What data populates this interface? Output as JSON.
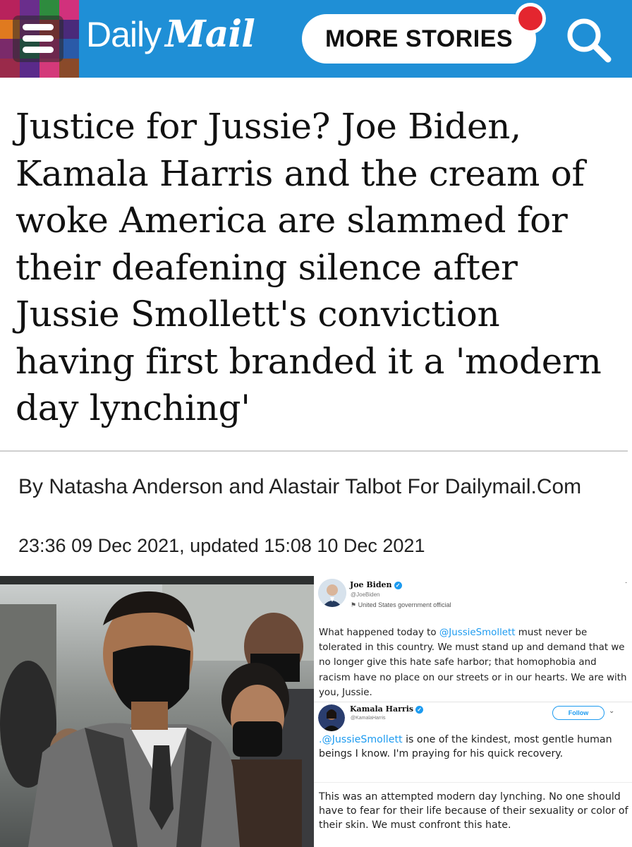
{
  "header": {
    "brand_daily": "Daily",
    "brand_mail": "Mail",
    "more_stories_label": "MORE STORIES",
    "menu_icon": "hamburger-menu-icon",
    "search_icon": "search-icon",
    "accent_color": "#1f8fd6",
    "notification_color": "#e4262f"
  },
  "article": {
    "headline": "Justice for Jussie? Joe Biden, Kamala Harris and the cream of woke America are slammed for their deafening silence after Jussie Smollett's conviction having first branded it a 'modern day lynching'",
    "byline": "By Natasha Anderson and Alastair Talbot For Dailymail.Com",
    "dateline": "23:36 09 Dec 2021, updated 15:08 10 Dec 2021"
  },
  "tweets": {
    "biden": {
      "name": "Joe Biden",
      "handle": "@JoeBiden",
      "label": "United States government official",
      "mention": "@JussieSmollett",
      "text_before": "What happened today to ",
      "text_after": " must never be tolerated in this country. We must stand up and demand that we no longer give this hate safe harbor; that homophobia and racism have no place on our streets or in our hearts. We are with you, Jussie."
    },
    "harris": {
      "name": "Kamala Harris",
      "handle": "@KamalaHarris",
      "follow_label": "Follow",
      "mention": ".@JussieSmollett",
      "text_after": " is one of the kindest, most gentle human beings I know. I'm praying for his quick recovery.",
      "text_2": "This was an attempted modern day lynching. No one should have to fear for their life because of their sexuality or color of their skin. We must confront this hate."
    }
  }
}
